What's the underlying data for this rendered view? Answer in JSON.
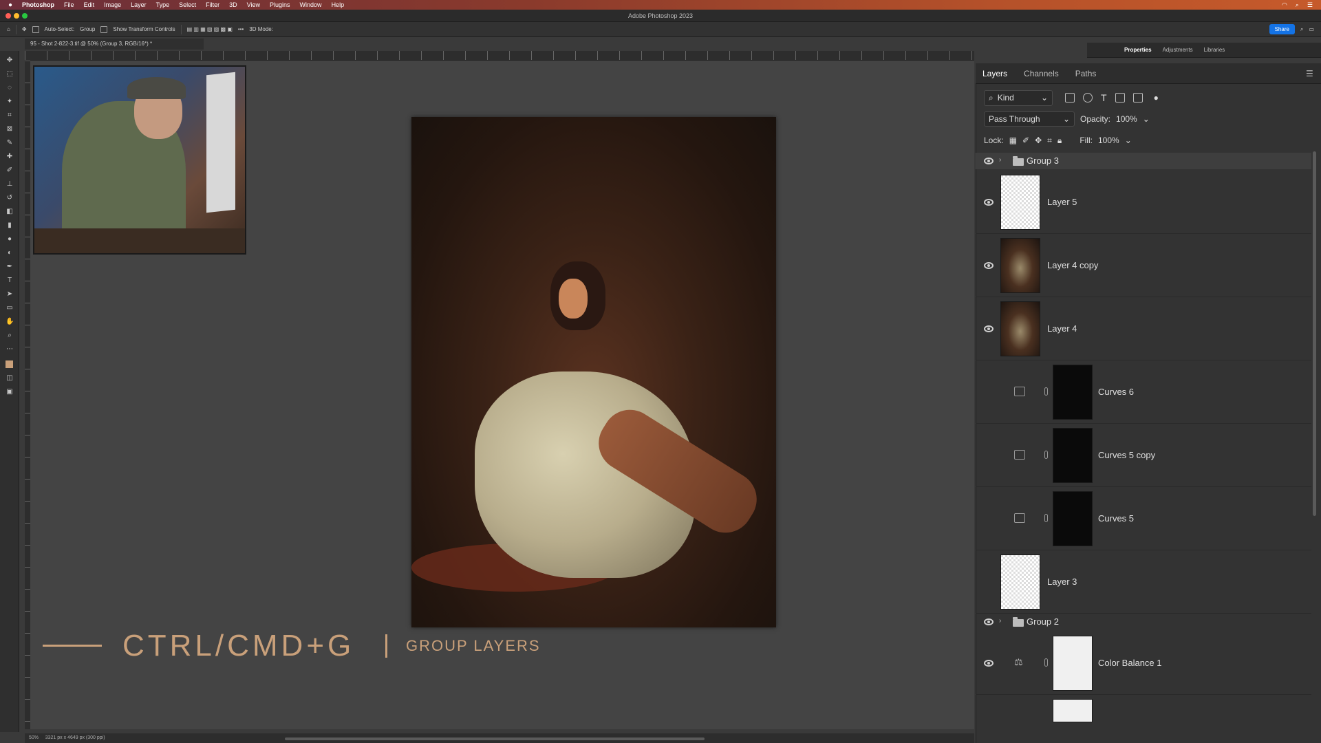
{
  "menubar": {
    "app_name": "Photoshop",
    "items": [
      "File",
      "Edit",
      "Image",
      "Layer",
      "Type",
      "Select",
      "Filter",
      "3D",
      "View",
      "Plugins",
      "Window",
      "Help"
    ]
  },
  "window": {
    "title": "Adobe Photoshop 2023"
  },
  "options_bar": {
    "auto_select_label": "Auto-Select:",
    "auto_select_value": "Group",
    "transform_label": "Show Transform Controls",
    "mode_3d_label": "3D Mode:",
    "share_label": "Share"
  },
  "document": {
    "tab_title": "95 - Shot 2-822-3.tif @ 50% (Group 3, RGB/16*) *",
    "zoom": "50%",
    "info": "3321 px x 4649 px (300 ppi)"
  },
  "caption": {
    "shortcut": "CTRL/CMD+G",
    "action": "GROUP LAYERS"
  },
  "panel_top": {
    "tabs": [
      "Properties",
      "Adjustments",
      "Libraries"
    ]
  },
  "layers_panel": {
    "tabs": [
      "Layers",
      "Channels",
      "Paths"
    ],
    "filter_kind": "Kind",
    "blend_mode": "Pass Through",
    "opacity_label": "Opacity:",
    "opacity_value": "100%",
    "lock_label": "Lock:",
    "fill_label": "Fill:",
    "fill_value": "100%",
    "layers": [
      {
        "name": "Group 3",
        "type": "group",
        "visible": true
      },
      {
        "name": "Layer 5",
        "type": "pixel",
        "visible": true
      },
      {
        "name": "Layer 4 copy",
        "type": "photo",
        "visible": true
      },
      {
        "name": "Layer 4",
        "type": "photo",
        "visible": true
      },
      {
        "name": "Curves 6",
        "type": "curves",
        "visible": false
      },
      {
        "name": "Curves 5 copy",
        "type": "curves",
        "visible": false
      },
      {
        "name": "Curves 5",
        "type": "curves",
        "visible": false
      },
      {
        "name": "Layer 3",
        "type": "pixel",
        "visible": false
      },
      {
        "name": "Group 2",
        "type": "group",
        "visible": true
      },
      {
        "name": "Color Balance 1",
        "type": "color-balance",
        "visible": true
      }
    ]
  },
  "colors": {
    "accent": "#1473e6",
    "caption": "#c9a07a"
  }
}
